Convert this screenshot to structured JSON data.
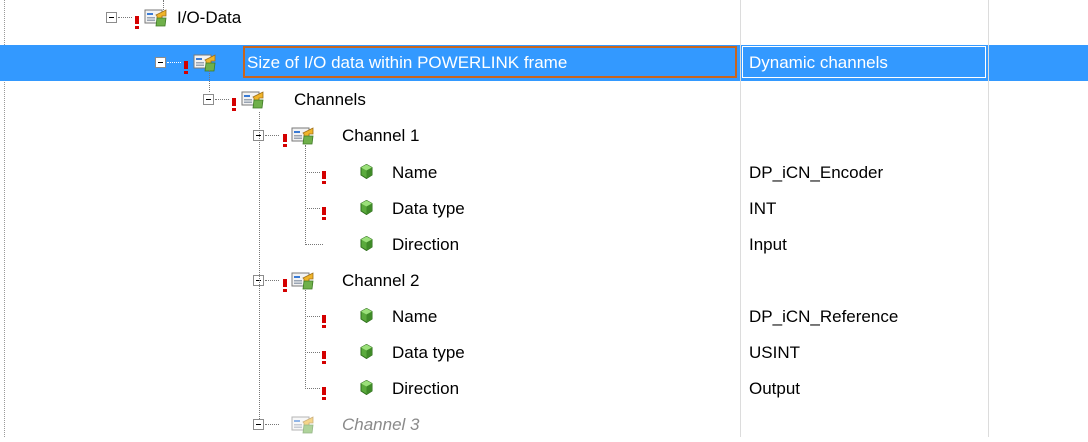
{
  "tree": {
    "rows": [
      {
        "label": "I/O-Data",
        "value": ""
      },
      {
        "label": "Size of I/O data within POWERLINK frame",
        "value": "Dynamic channels"
      },
      {
        "label": "Channels",
        "value": ""
      },
      {
        "label": "Channel 1",
        "value": ""
      },
      {
        "label": "Name",
        "value": "DP_iCN_Encoder"
      },
      {
        "label": "Data type",
        "value": "INT"
      },
      {
        "label": "Direction",
        "value": "Input"
      },
      {
        "label": "Channel 2",
        "value": ""
      },
      {
        "label": "Name",
        "value": "DP_iCN_Reference"
      },
      {
        "label": "Data type",
        "value": "USINT"
      },
      {
        "label": "Direction",
        "value": "Output"
      },
      {
        "label": "Channel 3",
        "value": ""
      }
    ]
  },
  "colors": {
    "selection": "#3399ff",
    "edit_border": "#c8651e",
    "error_marker": "#d40000"
  }
}
